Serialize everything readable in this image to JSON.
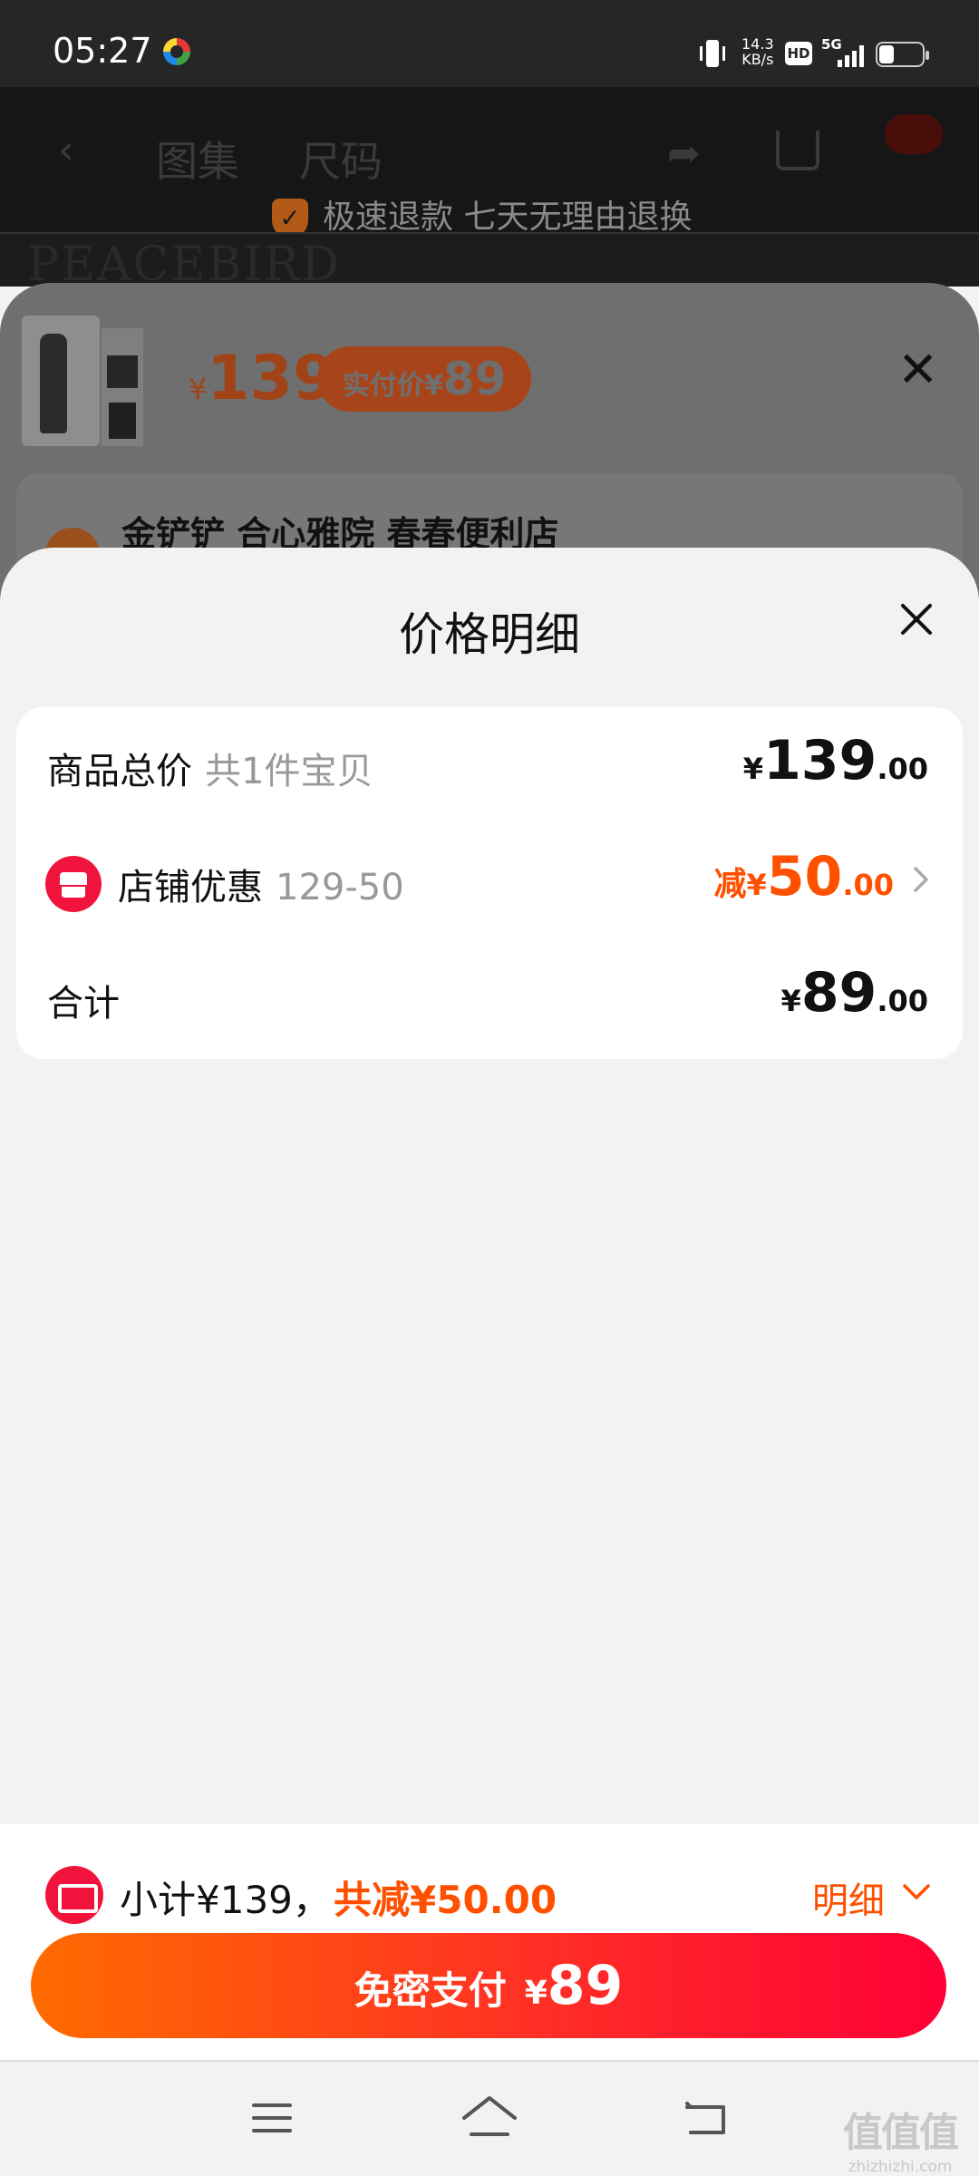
{
  "status_bar": {
    "time": "05:27",
    "speed_value": "14.3",
    "speed_unit": "KB/s",
    "hd": "HD",
    "network": "5G"
  },
  "background_page": {
    "tabs": [
      "图集",
      "尺码"
    ],
    "promise": "极速退款 七天无理由退换",
    "brand": "PEACEBIRD"
  },
  "sku_sheet": {
    "currency": "¥",
    "price": "139",
    "paid_label": "实付价",
    "paid_currency": "¥",
    "paid_value": "89",
    "store_line": "金铲铲 合心雅院 春春便利店"
  },
  "price_detail": {
    "title": "价格明细",
    "rows": [
      {
        "label": "商品总价",
        "sub": "共1件宝贝",
        "currency": "¥",
        "int": "139",
        "dec": ".00"
      },
      {
        "label": "店铺优惠",
        "sub": "129-50",
        "prefix": "减",
        "currency": "¥",
        "int": "50",
        "dec": ".00"
      },
      {
        "label": "合计",
        "currency": "¥",
        "int": "89",
        "dec": ".00"
      }
    ]
  },
  "bottom_bar": {
    "subtotal": "小计¥139，",
    "reduction": "共减¥50.00",
    "detail_label": "明细",
    "pay_label": "免密支付",
    "pay_currency": "¥",
    "pay_amount": "89"
  },
  "watermark": {
    "text": "值值值",
    "site": "zhizhizhi.com"
  },
  "colors": {
    "accent": "#ff5000",
    "brand_red": "#f0143c",
    "pay_gradient_start": "#ff6b00",
    "pay_gradient_end": "#ff0036"
  },
  "icons": [
    "app-icon",
    "vibrate-icon",
    "signal-icon",
    "battery-icon",
    "close-icon",
    "store-icon",
    "chevron-right-icon",
    "coupon-icon",
    "chevron-down-icon",
    "menu-icon",
    "home-icon",
    "back-icon"
  ]
}
